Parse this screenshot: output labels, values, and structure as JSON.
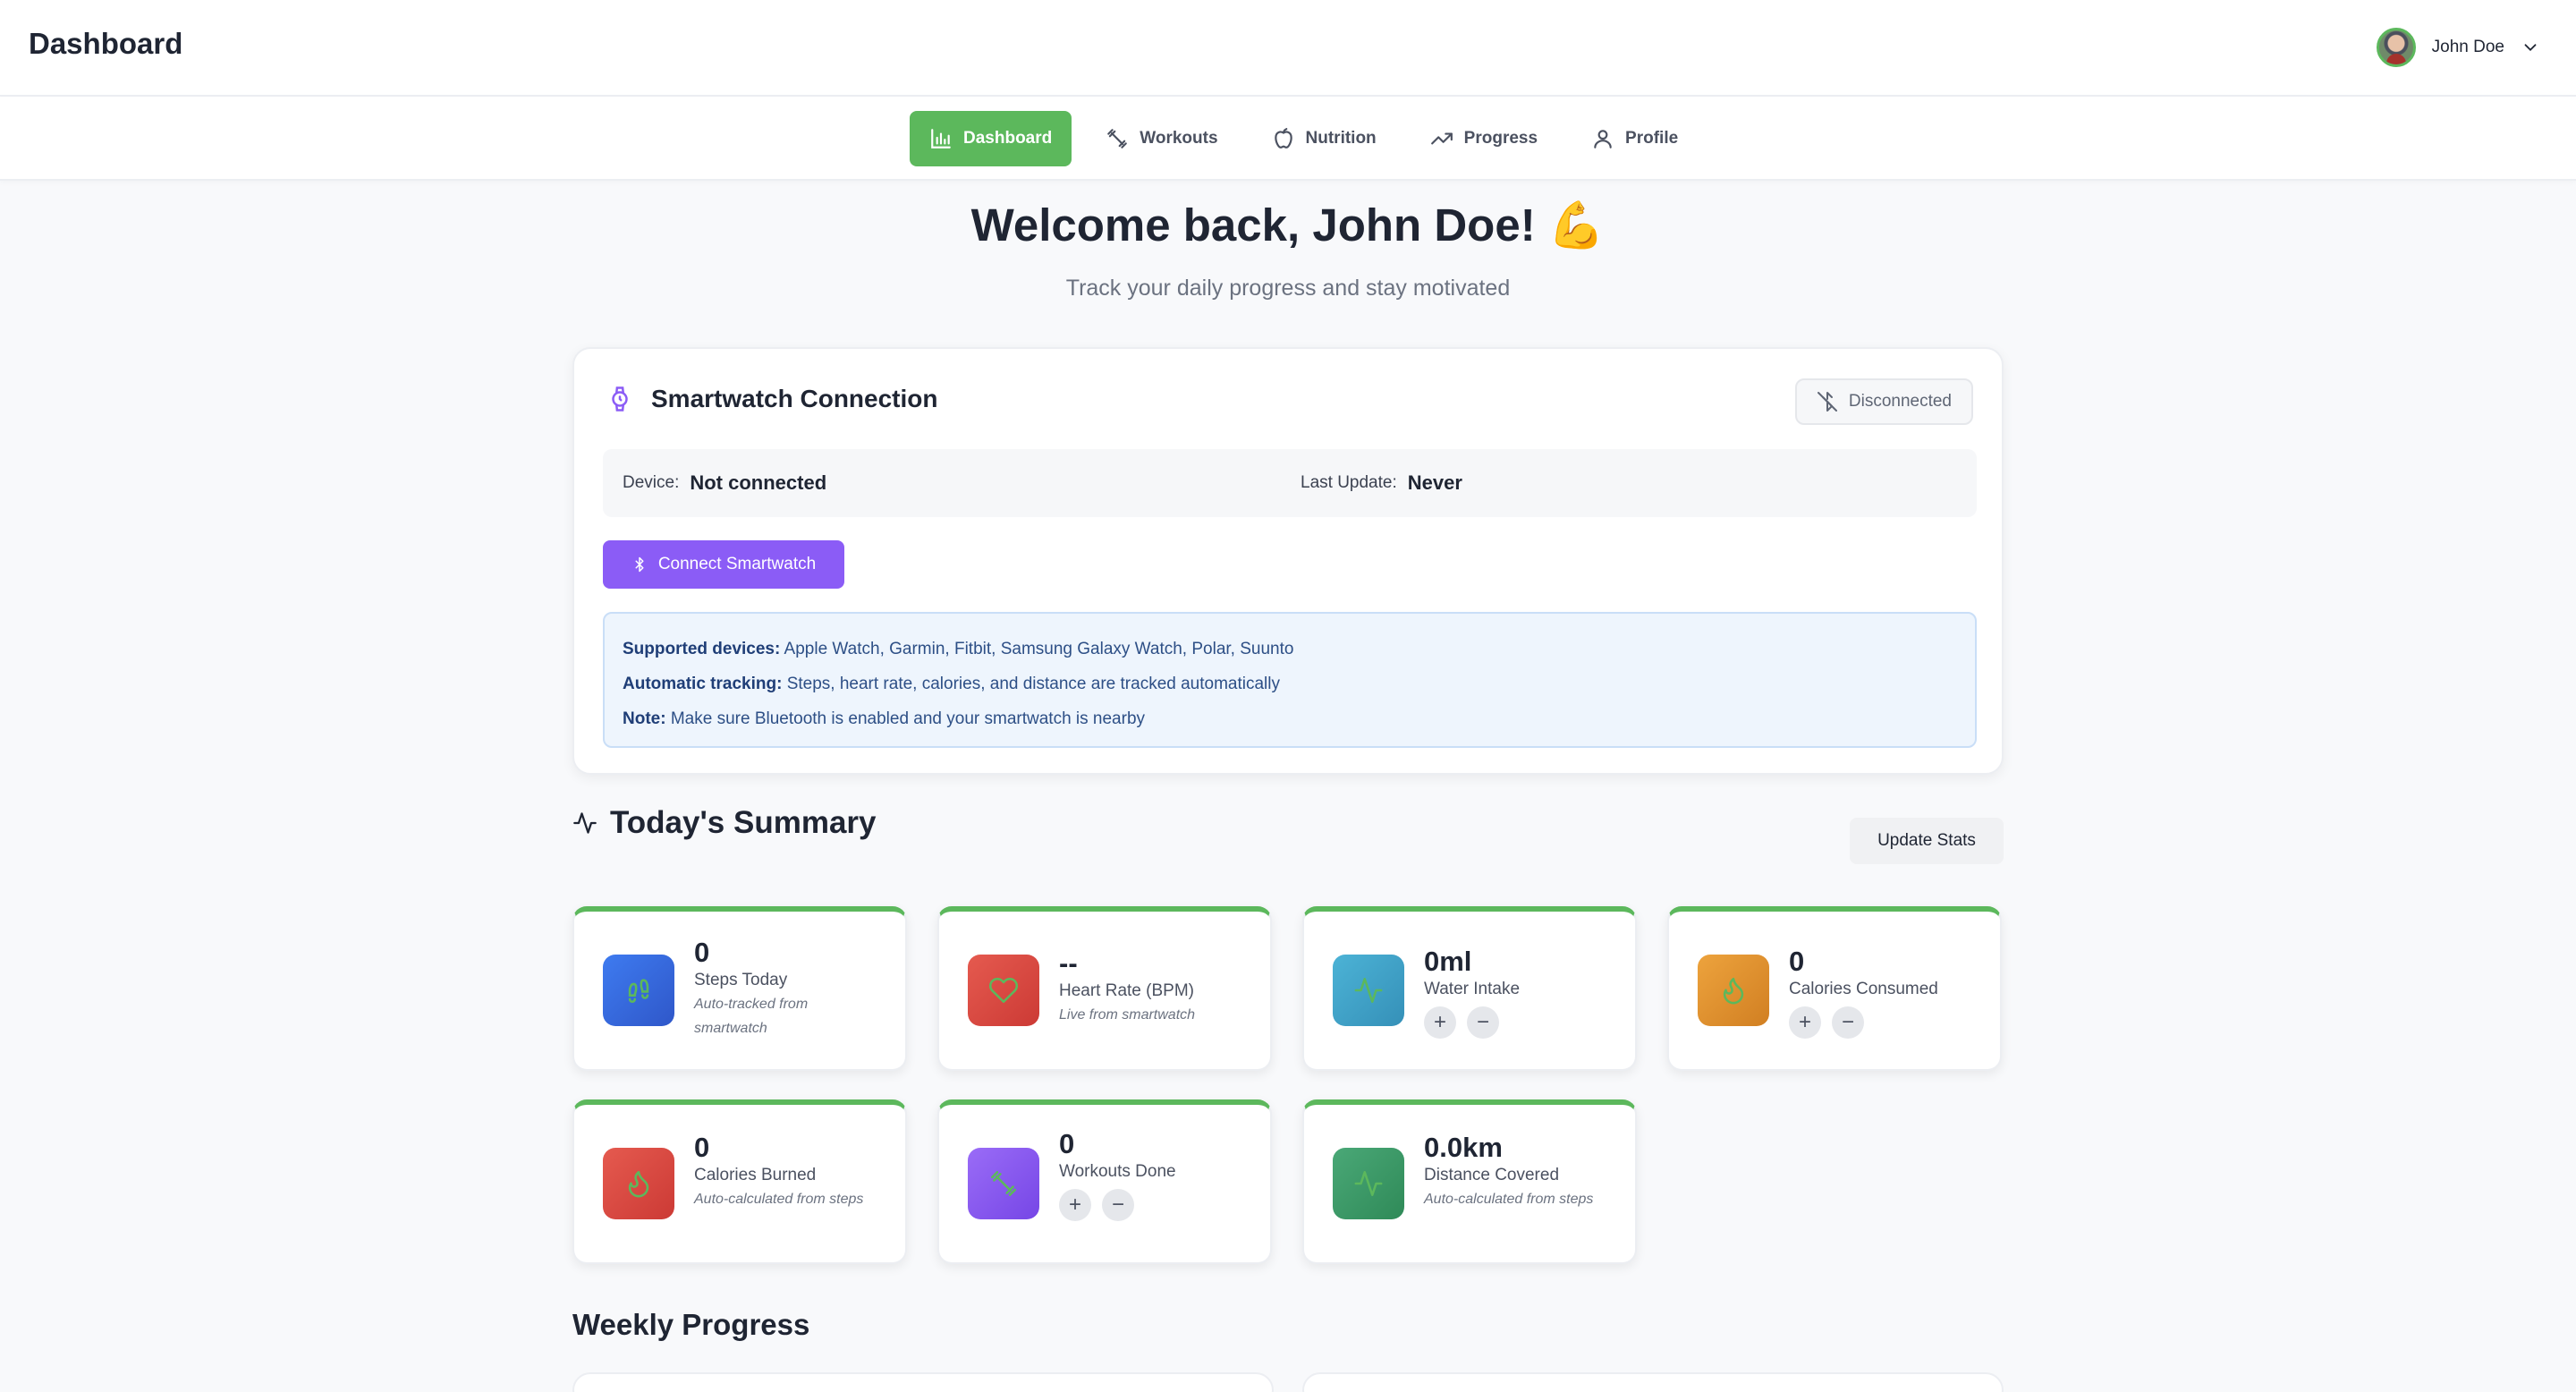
{
  "header": {
    "app_title": "Dashboard",
    "user_name": "John Doe"
  },
  "nav": {
    "tabs": [
      {
        "label": "Dashboard",
        "icon": "bar-chart-icon",
        "active": true
      },
      {
        "label": "Workouts",
        "icon": "dumbbell-icon",
        "active": false
      },
      {
        "label": "Nutrition",
        "icon": "apple-icon",
        "active": false
      },
      {
        "label": "Progress",
        "icon": "trending-up-icon",
        "active": false
      },
      {
        "label": "Profile",
        "icon": "user-icon",
        "active": false
      }
    ]
  },
  "hero": {
    "title": "Welcome back, John Doe! 💪",
    "subtitle": "Track your daily progress and stay motivated"
  },
  "smartwatch": {
    "title": "Smartwatch Connection",
    "status": "Disconnected",
    "device_label": "Device:",
    "device_value": "Not connected",
    "last_update_label": "Last Update:",
    "last_update_value": "Never",
    "connect_label": "Connect Smartwatch",
    "notes": [
      {
        "label": "Supported devices:",
        "text": " Apple Watch, Garmin, Fitbit, Samsung Galaxy Watch, Polar, Suunto"
      },
      {
        "label": "Automatic tracking:",
        "text": " Steps, heart rate, calories, and distance are tracked automatically"
      },
      {
        "label": "Note:",
        "text": " Make sure Bluetooth is enabled and your smartwatch is nearby"
      }
    ]
  },
  "summary": {
    "title": "Today's Summary",
    "update_label": "Update Stats",
    "stats": [
      {
        "value": "0",
        "label": "Steps Today",
        "note": "Auto-tracked from smartwatch",
        "icon": "footprints-icon",
        "color": "#3b6fe0"
      },
      {
        "value": "--",
        "label": "Heart Rate (BPM)",
        "note": "Live from smartwatch",
        "icon": "heart-icon",
        "color": "#dc4a43"
      },
      {
        "value": "0ml",
        "label": "Water Intake",
        "note": "",
        "icon": "activity-icon",
        "color": "#3fa3c7"
      },
      {
        "value": "0",
        "label": "Calories Consumed",
        "note": "",
        "icon": "flame-icon",
        "color": "#e3922e"
      },
      {
        "value": "0",
        "label": "Calories Burned",
        "note": "Auto-calculated from steps",
        "icon": "flame-icon",
        "color": "#dc4a43"
      },
      {
        "value": "0",
        "label": "Workouts Done",
        "note": "",
        "icon": "dumbbell-icon",
        "color": "#8b5cf6"
      },
      {
        "value": "0.0km",
        "label": "Distance Covered",
        "note": "Auto-calculated from steps",
        "icon": "activity-icon",
        "color": "#3f9f6a"
      }
    ],
    "stepper_plus": "+",
    "stepper_minus": "−"
  },
  "weekly": {
    "title": "Weekly Progress"
  },
  "colors": {
    "accent_green": "#5cb85c",
    "accent_purple": "#8b5cf6",
    "notes_bg": "#eef5fd"
  }
}
